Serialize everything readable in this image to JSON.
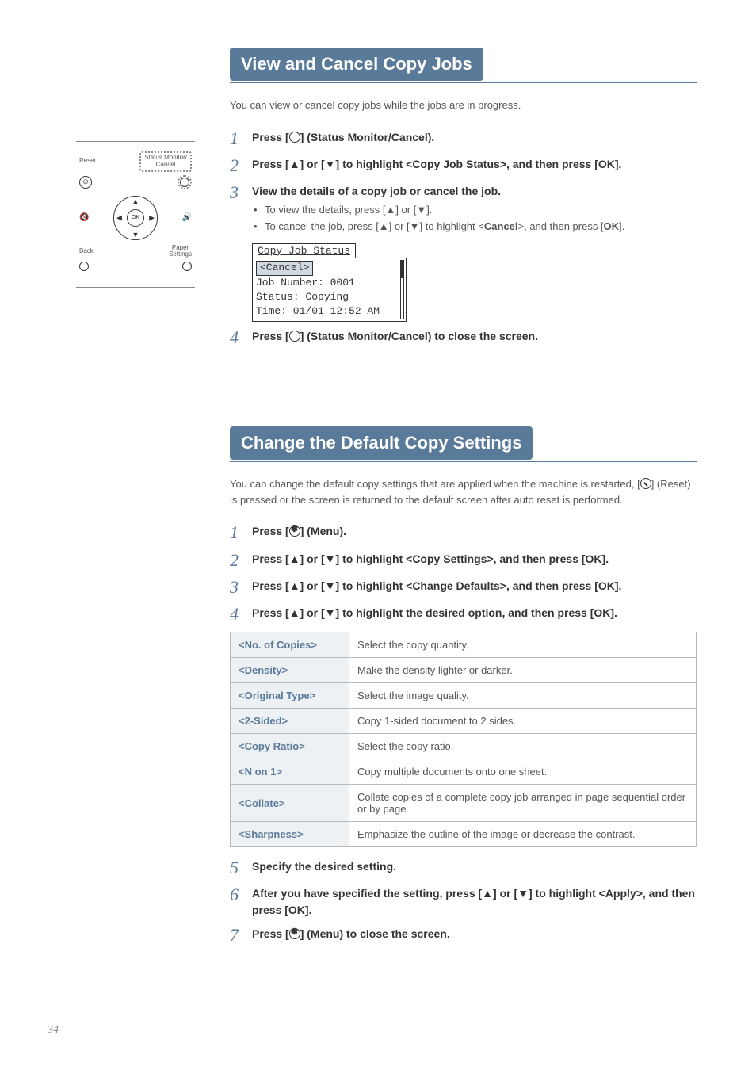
{
  "page_number": "34",
  "illustration": {
    "reset_label": "Reset",
    "status_label": "Status Monitor/\nCancel",
    "back_label": "Back",
    "paper_label": "Paper\nSettings",
    "ok_label": "OK"
  },
  "section1": {
    "title": "View and Cancel Copy Jobs",
    "intro": "You can view or cancel copy jobs while the jobs are in progress.",
    "steps": {
      "s1_a": "Press [",
      "s1_b": "] (Status Monitor/Cancel).",
      "s2": "Press [▲] or [▼] to highlight <Copy Job Status>, and then press [OK].",
      "s3": "View the details of a copy job or cancel the job.",
      "s3_b1": "To view the details, press [▲] or [▼].",
      "s3_b2_a": "To cancel the job, press [▲] or [▼] to highlight <",
      "s3_b2_cancel": "Cancel",
      "s3_b2_b": ">, and then press [",
      "s3_b2_ok": "OK",
      "s3_b2_c": "].",
      "s4_a": "Press [",
      "s4_b": "] (Status Monitor/Cancel) to close the screen."
    },
    "lcd": {
      "title": "Copy Job Status",
      "line1": "<Cancel>",
      "line2": "Job Number: 0001",
      "line3": "Status: Copying",
      "line4": "Time: 01/01 12:52 AM"
    }
  },
  "section2": {
    "title": "Change the Default Copy Settings",
    "intro_a": "You can change the default copy settings that are applied when the machine is restarted, [",
    "intro_b": "] (Reset) is pressed or the screen is returned to the default screen after auto reset is performed.",
    "steps": {
      "s1_a": "Press [",
      "s1_b": "] (Menu).",
      "s2": "Press [▲] or [▼] to highlight <Copy Settings>, and then press [OK].",
      "s3": "Press [▲] or [▼] to highlight <Change Defaults>, and then press [OK].",
      "s4": "Press [▲] or [▼] to highlight the desired option, and then press [OK].",
      "s5": "Specify the desired setting.",
      "s6": "After you have specified the setting, press [▲] or [▼] to highlight <Apply>, and then press [OK].",
      "s7_a": "Press [",
      "s7_b": "] (Menu) to close the screen."
    },
    "options": [
      {
        "label": "<No. of Copies>",
        "desc": "Select the copy quantity."
      },
      {
        "label": "<Density>",
        "desc": "Make the density lighter or darker."
      },
      {
        "label": "<Original Type>",
        "desc": "Select the image quality."
      },
      {
        "label": "<2-Sided>",
        "desc": "Copy 1-sided document to 2 sides."
      },
      {
        "label": "<Copy Ratio>",
        "desc": "Select the copy ratio."
      },
      {
        "label": "<N on 1>",
        "desc": "Copy multiple documents onto one sheet."
      },
      {
        "label": "<Collate>",
        "desc": "Collate copies of a complete copy job arranged in page sequential order or by page."
      },
      {
        "label": "<Sharpness>",
        "desc": "Emphasize the outline of the image or decrease the contrast."
      }
    ]
  }
}
